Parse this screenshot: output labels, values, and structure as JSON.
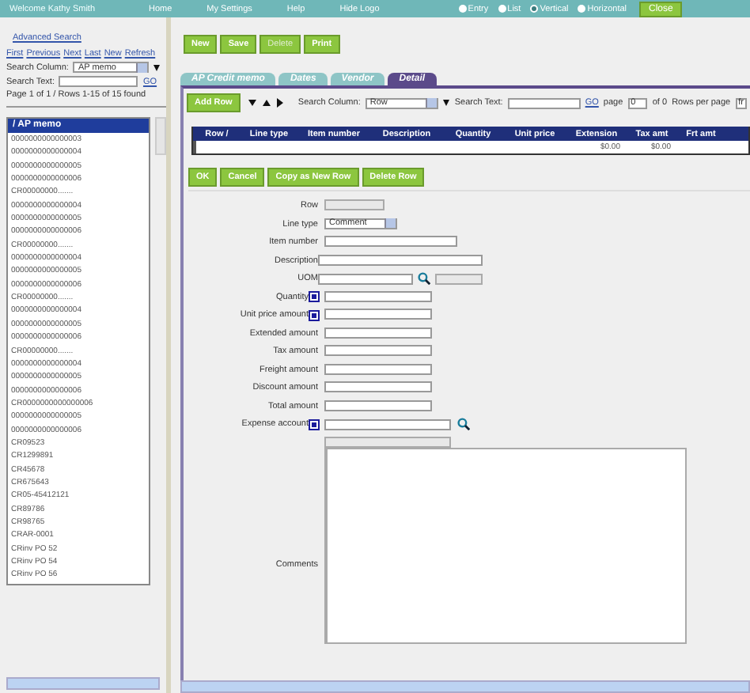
{
  "header": {
    "welcome": "Welcome Kathy Smith",
    "nav": [
      "Home",
      "My Settings",
      "Help",
      "Hide Logo"
    ],
    "views": [
      {
        "label": "Entry",
        "selected": false
      },
      {
        "label": "List",
        "selected": false
      },
      {
        "label": "Vertical",
        "selected": true
      },
      {
        "label": "Horizontal",
        "selected": false
      }
    ],
    "close": "Close"
  },
  "search_panel": {
    "advanced_search": "Advanced Search",
    "nav_links": [
      "First",
      "Previous",
      "Next",
      "Last",
      "New",
      "Refresh"
    ],
    "search_column_label": "Search Column:",
    "search_column_value": "AP memo",
    "search_text_label": "Search Text:",
    "go": "GO",
    "page_info": "Page 1 of 1 / Rows 1-15 of 15 found",
    "list_header": "AP memo",
    "sort_mark": "/",
    "items": [
      "0000000000000003",
      "0000000000000004",
      "0000000000000005",
      "0000000000000006",
      "CR00000000.......",
      "0000000000000004",
      "0000000000000005",
      "0000000000000006",
      "CR00000000.......",
      "0000000000000004",
      "0000000000000005",
      "0000000000000006",
      "CR00000000.......",
      "0000000000000004",
      "0000000000000005",
      "0000000000000006",
      "CR00000000.......",
      "0000000000000004",
      "0000000000000005",
      "0000000000000006",
      "CR0000000000000006",
      "0000000000000005",
      "0000000000000006",
      "CR09523",
      "CR1299891",
      "CR45678",
      "CR675643",
      "CR05-45412121",
      "CR89786",
      "CR98765",
      "CRAR-0001",
      "CRinv PO 52",
      "CRinv PO 54",
      "CRinv PO 56"
    ]
  },
  "toolbar": [
    {
      "label": "New",
      "disabled": false
    },
    {
      "label": "Save",
      "disabled": false
    },
    {
      "label": "Delete",
      "disabled": true
    },
    {
      "label": "Print",
      "disabled": false
    }
  ],
  "tabs": [
    {
      "label": "AP Credit memo",
      "selected": false
    },
    {
      "label": "Dates",
      "selected": false
    },
    {
      "label": "Vendor",
      "selected": false
    },
    {
      "label": "Detail",
      "selected": true
    }
  ],
  "grid": {
    "add_row": "Add Row",
    "search_column_label": "Search Column:",
    "search_column_value": "Row",
    "search_text_label": "Search Text:",
    "go": "GO",
    "page_label": "page",
    "page_value": "0",
    "of_label": "of 0",
    "rows_per_page_label": "Rows per page",
    "rows_per_page_value": "fr",
    "columns": [
      "Row",
      "Line type",
      "Item number",
      "Description",
      "Quantity",
      "Unit price",
      "Extension",
      "Tax amt",
      "Frt amt"
    ],
    "sort_mark": "/",
    "rows": [
      {
        "cells": [
          "",
          "",
          "",
          "",
          "",
          "",
          "$0.00",
          "$0.00",
          ""
        ]
      }
    ]
  },
  "row_buttons": [
    "OK",
    "Cancel",
    "Copy as New Row",
    "Delete Row"
  ],
  "form": [
    {
      "label": "Row",
      "kind": "readonly",
      "required": false
    },
    {
      "label": "Line type",
      "kind": "select",
      "value": "Comment",
      "required": false
    },
    {
      "label": "Item number",
      "kind": "medium",
      "required": false
    },
    {
      "label": "Description",
      "kind": "wide",
      "required": false
    },
    {
      "label": "UOM",
      "kind": "uom",
      "required": false
    },
    {
      "label": "Quantity",
      "kind": "short",
      "required": true
    },
    {
      "label": "Unit price amount",
      "kind": "short",
      "required": true
    },
    {
      "label": "Extended amount",
      "kind": "short",
      "required": false
    },
    {
      "label": "Tax amount",
      "kind": "short",
      "required": false
    },
    {
      "label": "Freight amount",
      "kind": "short",
      "required": false
    },
    {
      "label": "Discount amount",
      "kind": "short",
      "required": false
    },
    {
      "label": "Total amount",
      "kind": "short",
      "required": false
    },
    {
      "label": "Expense account",
      "kind": "lookup",
      "required": true
    },
    {
      "label": "Comments",
      "kind": "textarea",
      "required": false
    }
  ]
}
